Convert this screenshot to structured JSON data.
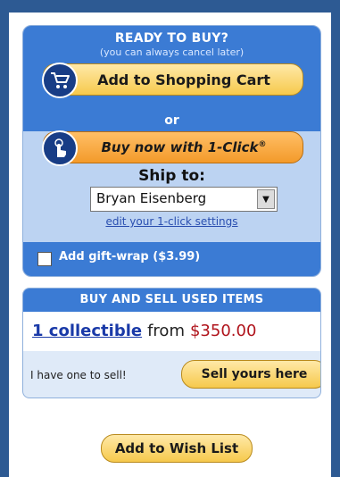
{
  "buy_box": {
    "title": "READY TO BUY?",
    "subtitle": "(you can always cancel later)",
    "add_to_cart_label": "Add to Shopping Cart",
    "or_label": "or",
    "one_click_label": "Buy now with 1-Click",
    "one_click_mark": "®",
    "ship_to_label": "Ship to:",
    "ship_to_value": "Bryan Eisenberg",
    "edit_settings_link": "edit your 1-click settings",
    "gift_wrap_label": "Add gift-wrap ($3.99)",
    "gift_wrap_checked": false
  },
  "used_box": {
    "title": "BUY AND SELL USED ITEMS",
    "collectible_link": "1 collectible",
    "from_label": "from",
    "price": "$350.00",
    "sell_prompt": "I have one to sell!",
    "sell_button": "Sell yours here"
  },
  "wish_list_button": "Add to Wish List",
  "colors": {
    "page_background": "#2d5a93",
    "panel_blue": "#3b7bd4",
    "button_yellow": "#f6c94c",
    "button_orange": "#f39a2a",
    "price_red": "#b0141c",
    "link_blue": "#1a3aa8"
  },
  "icons": {
    "cart": "shopping-cart-icon",
    "one_click": "hand-click-icon",
    "dropdown": "chevron-down-icon"
  }
}
